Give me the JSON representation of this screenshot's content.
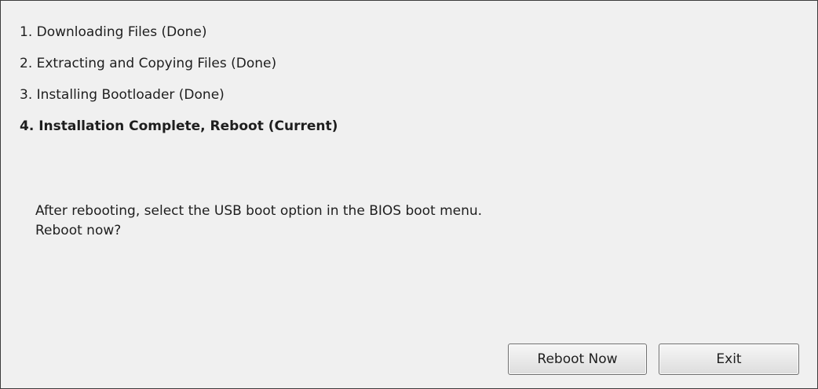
{
  "steps": [
    {
      "label": "1. Downloading Files (Done)",
      "current": false
    },
    {
      "label": "2. Extracting and Copying Files (Done)",
      "current": false
    },
    {
      "label": "3. Installing Bootloader (Done)",
      "current": false
    },
    {
      "label": "4. Installation Complete, Reboot (Current)",
      "current": true
    }
  ],
  "message": {
    "line1": "After rebooting, select the USB boot option in the BIOS boot menu.",
    "line2": "Reboot now?"
  },
  "buttons": {
    "reboot_label": "Reboot Now",
    "exit_label": "Exit"
  }
}
